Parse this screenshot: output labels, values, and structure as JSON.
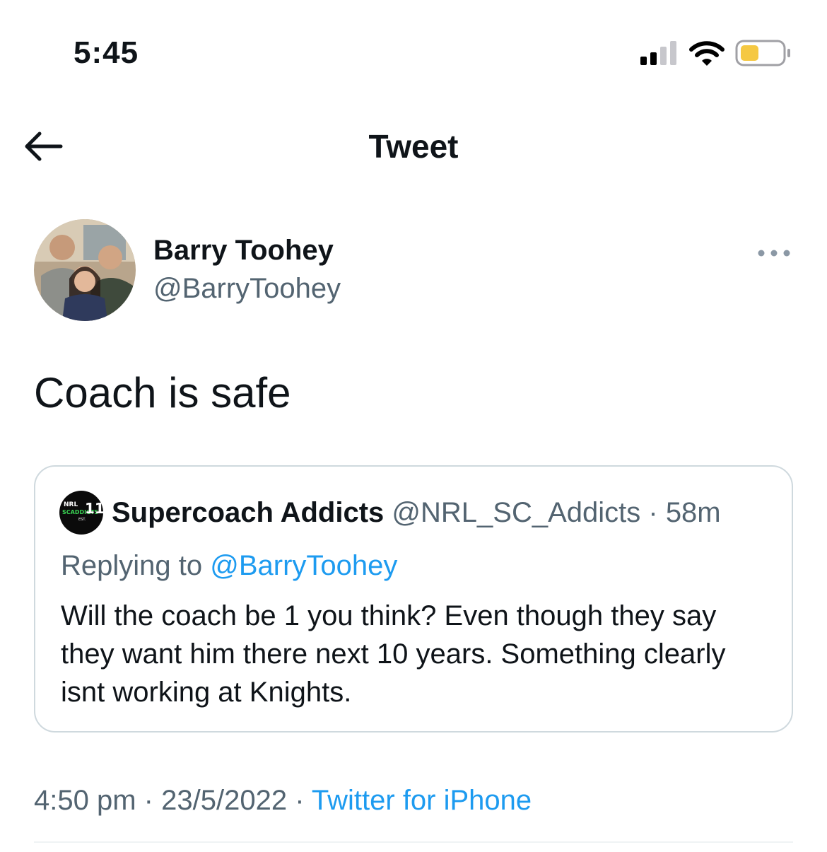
{
  "status_bar": {
    "time": "5:45",
    "signal_icon": "cellular-signal-icon",
    "wifi_icon": "wifi-icon",
    "battery_icon": "battery-icon",
    "battery_level": 0.45,
    "battery_color": "#f5c842"
  },
  "header": {
    "back_icon": "back-arrow-icon",
    "title": "Tweet"
  },
  "tweet": {
    "author_name": "Barry Toohey",
    "author_handle": "@BarryToohey",
    "more_icon": "more-icon",
    "text": "Coach is safe",
    "quote": {
      "author_name": "Supercoach Addicts",
      "author_handle": "@NRL_SC_Addicts",
      "separator": "·",
      "time": "58m",
      "avatar_lines": [
        "NRL",
        "SCADDICTS",
        "11",
        "EST."
      ],
      "replying_prefix": "Replying to",
      "replying_mention": "@BarryToohey",
      "text": "Will the coach be 1 you think? Even though they say they want him there next 10 years. Something clearly isnt working at Knights."
    },
    "meta": {
      "time": "4:50 pm",
      "separator": "·",
      "date": "23/5/2022",
      "source": "Twitter for iPhone"
    }
  },
  "colors": {
    "accent": "#1d9bf0",
    "secondary_text": "#536471",
    "border": "#cfd9de"
  }
}
